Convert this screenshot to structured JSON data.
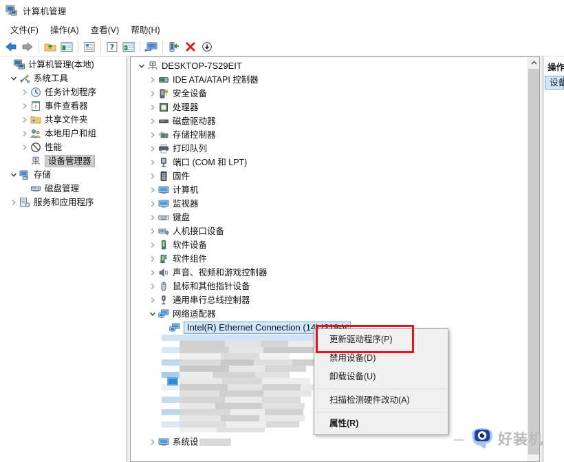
{
  "window": {
    "title": "计算机管理",
    "icon": "computer-management-icon"
  },
  "menubar": {
    "items": [
      {
        "label": "文件(F)",
        "name": "menu-file"
      },
      {
        "label": "操作(A)",
        "name": "menu-action"
      },
      {
        "label": "查看(V)",
        "name": "menu-view"
      },
      {
        "label": "帮助(H)",
        "name": "menu-help"
      }
    ]
  },
  "toolbar": {
    "buttons": [
      {
        "name": "back-icon",
        "title": "后退"
      },
      {
        "name": "forward-icon",
        "title": "前进"
      },
      {
        "name": "up-folder-icon",
        "title": "上移一级"
      },
      {
        "name": "show-hide-console-tree-icon",
        "title": "显示/隐藏控制台树"
      },
      {
        "name": "properties-icon",
        "title": "属性"
      },
      {
        "name": "help-icon",
        "title": "帮助"
      },
      {
        "name": "show-hide-action-pane-icon",
        "title": "显示/隐藏操作窗格"
      },
      {
        "name": "scan-hardware-icon",
        "title": "扫描检测硬件改动"
      },
      {
        "name": "update-driver-icon",
        "title": "更新驱动程序"
      },
      {
        "name": "uninstall-device-icon",
        "title": "卸载设备"
      },
      {
        "name": "disable-device-icon",
        "title": "禁用设备"
      }
    ]
  },
  "sidebar": {
    "items": [
      {
        "label": "计算机管理(本地)",
        "indent": 0,
        "expander": "none",
        "icon": "computer-management-icon",
        "selected": false
      },
      {
        "label": "系统工具",
        "indent": 1,
        "expander": "expanded",
        "icon": "system-tools-icon",
        "selected": false
      },
      {
        "label": "任务计划程序",
        "indent": 2,
        "expander": "collapsed",
        "icon": "task-scheduler-icon",
        "selected": false
      },
      {
        "label": "事件查看器",
        "indent": 2,
        "expander": "collapsed",
        "icon": "event-viewer-icon",
        "selected": false
      },
      {
        "label": "共享文件夹",
        "indent": 2,
        "expander": "collapsed",
        "icon": "shared-folders-icon",
        "selected": false
      },
      {
        "label": "本地用户和组",
        "indent": 2,
        "expander": "collapsed",
        "icon": "local-users-groups-icon",
        "selected": false
      },
      {
        "label": "性能",
        "indent": 2,
        "expander": "collapsed",
        "icon": "performance-icon",
        "selected": false
      },
      {
        "label": "设备管理器",
        "indent": 2,
        "expander": "none",
        "icon": "device-manager-icon",
        "selected": true
      },
      {
        "label": "存储",
        "indent": 1,
        "expander": "expanded",
        "icon": "storage-icon",
        "selected": false
      },
      {
        "label": "磁盘管理",
        "indent": 2,
        "expander": "none",
        "icon": "disk-management-icon",
        "selected": false
      },
      {
        "label": "服务和应用程序",
        "indent": 1,
        "expander": "collapsed",
        "icon": "services-apps-icon",
        "selected": false
      }
    ]
  },
  "device_tree": {
    "root": {
      "label": "DESKTOP-7S29EIT",
      "icon": "computer-node-icon",
      "expander": "expanded"
    },
    "items": [
      {
        "label": "IDE ATA/ATAPI 控制器",
        "icon": "ide-controller-icon",
        "expander": "collapsed"
      },
      {
        "label": "安全设备",
        "icon": "security-device-icon",
        "expander": "collapsed"
      },
      {
        "label": "处理器",
        "icon": "processor-icon",
        "expander": "collapsed"
      },
      {
        "label": "磁盘驱动器",
        "icon": "disk-drive-icon",
        "expander": "collapsed"
      },
      {
        "label": "存储控制器",
        "icon": "storage-controller-icon",
        "expander": "collapsed"
      },
      {
        "label": "打印队列",
        "icon": "print-queue-icon",
        "expander": "collapsed"
      },
      {
        "label": "端口 (COM 和 LPT)",
        "icon": "ports-icon",
        "expander": "collapsed"
      },
      {
        "label": "固件",
        "icon": "firmware-icon",
        "expander": "collapsed"
      },
      {
        "label": "计算机",
        "icon": "computer-icon",
        "expander": "collapsed"
      },
      {
        "label": "监视器",
        "icon": "monitor-icon",
        "expander": "collapsed"
      },
      {
        "label": "键盘",
        "icon": "keyboard-icon",
        "expander": "collapsed"
      },
      {
        "label": "人机接口设备",
        "icon": "hid-icon",
        "expander": "collapsed"
      },
      {
        "label": "软件设备",
        "icon": "software-device-icon",
        "expander": "collapsed"
      },
      {
        "label": "软件组件",
        "icon": "software-component-icon",
        "expander": "collapsed"
      },
      {
        "label": "声音、视频和游戏控制器",
        "icon": "sound-video-game-icon",
        "expander": "collapsed"
      },
      {
        "label": "鼠标和其他指针设备",
        "icon": "mouse-icon",
        "expander": "collapsed"
      },
      {
        "label": "通用串行总线控制器",
        "icon": "usb-controller-icon",
        "expander": "collapsed"
      },
      {
        "label": "网络适配器",
        "icon": "network-adapter-icon",
        "expander": "expanded"
      }
    ],
    "selected_device": {
      "label": "Intel(R) Ethernet Connection (14) I219-V",
      "icon": "network-adapter-icon",
      "selected": true
    },
    "last_item": {
      "label": "系统设",
      "icon": "system-devices-icon",
      "expander": "collapsed"
    }
  },
  "context_menu": {
    "items": [
      {
        "label": "更新驱动程序(P)",
        "name": "ctx-update-driver",
        "bold": false,
        "highlighted": true
      },
      {
        "label": "禁用设备(D)",
        "name": "ctx-disable-device",
        "bold": false,
        "highlighted": false
      },
      {
        "label": "卸载设备(U)",
        "name": "ctx-uninstall-device",
        "bold": false,
        "highlighted": false
      },
      {
        "label": "扫描检测硬件改动(A)",
        "name": "ctx-scan-hardware",
        "bold": false,
        "highlighted": false
      },
      {
        "label": "属性(R)",
        "name": "ctx-properties",
        "bold": true,
        "highlighted": false
      }
    ],
    "separators_after": [
      2,
      3
    ],
    "highlight_color": "#ee1111"
  },
  "actions_pane": {
    "header": "操作",
    "selected_item": "设备"
  },
  "watermark": {
    "text": "好装机",
    "logo": "eye-logo-icon"
  },
  "colors": {
    "selection_blue": "#cde8ff",
    "selection_gray": "#cdcdcd",
    "red_highlight": "#ee1111",
    "pane_border": "#a0a0a0"
  }
}
